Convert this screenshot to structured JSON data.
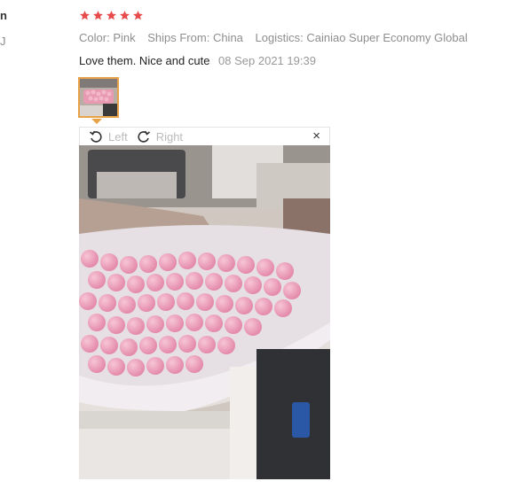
{
  "sidebar_fragment": {
    "line1": "n",
    "line2": "J"
  },
  "review": {
    "rating": 5,
    "star_color": "#e84b4b",
    "attributes": [
      {
        "key": "Color:",
        "value": "Pink"
      },
      {
        "key": "Ships From:",
        "value": "China"
      },
      {
        "key": "Logistics:",
        "value": "Cainiao Super Economy Global"
      }
    ],
    "text": "Love them. Nice and cute",
    "date": "08 Sep 2021 19:39"
  },
  "viewer": {
    "rotate_left_label": "Left",
    "rotate_right_label": "Right",
    "close_label": "×"
  }
}
